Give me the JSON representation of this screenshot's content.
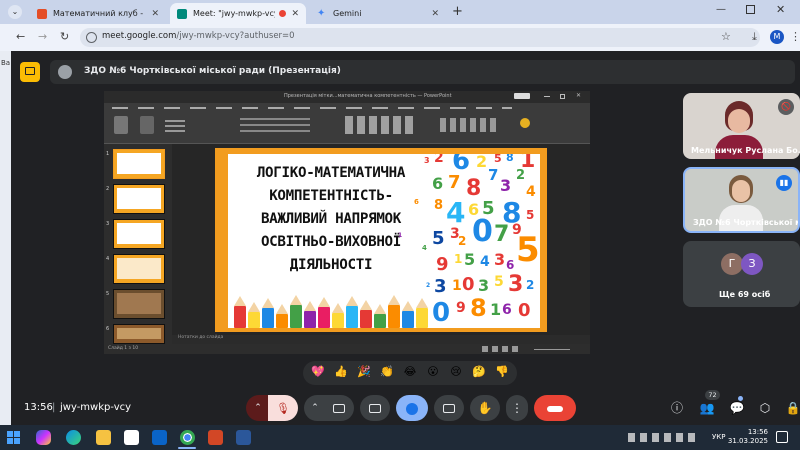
{
  "browser": {
    "tabs": [
      {
        "title": "Математичний клуб - rumelnyk...",
        "favicon": "blogger-icon",
        "color": "#e44d26",
        "active": false
      },
      {
        "title": "Meet: \"jwy-mwkp-vcy\"",
        "favicon": "meet-icon",
        "color": "#00897b",
        "active": true
      },
      {
        "title": "Gemini",
        "favicon": "gemini-icon",
        "color": "#4285f4",
        "active": false
      }
    ],
    "url_host": "meet.google.com",
    "url_path": "/jwy-mwkp-vcy?authuser=0",
    "profile_initial": "M",
    "left_strip_text": "Ba"
  },
  "meet": {
    "presentation_title": "ЗДО №6 Чортківської міської ради (Презентація)",
    "time": "13:56",
    "meeting_code": "jwy-mwkp-vcy",
    "participants": [
      {
        "name": "Мельничук Руслана Бо...",
        "muted": true
      },
      {
        "name": "ЗДО №6 Чортківської м...",
        "speaking": true
      }
    ],
    "others": {
      "label": "Ще 69 осіб",
      "avatars": [
        {
          "initial": "Г",
          "color": "#8d6e63"
        },
        {
          "initial": "З",
          "color": "#7e57c2"
        }
      ]
    },
    "reactions": [
      "💖",
      "👍",
      "🎉",
      "👏",
      "😂",
      "😮",
      "😢",
      "🤔",
      "👎"
    ],
    "people_count": "72"
  },
  "ppt": {
    "window_title": "Презентація мітки...математична компетентність — PowerPoint",
    "notes_placeholder": "Нотатки до слайда",
    "slide_numbers": [
      "1",
      "2",
      "3",
      "4",
      "5",
      "6"
    ],
    "slide_title_lines": [
      "ЛОГІКО-МАТЕМАТИЧНА",
      "КОМПЕТЕНТНІСТЬ-",
      "ВАЖЛИВИЙ НАПРЯМОК",
      "ОСВІТНЬО-ВИХОВНОЇ",
      "ДІЯЛЬНОСТІ"
    ],
    "status_left": "Слайд 1 з 10"
  },
  "taskbar": {
    "lang": "УКР",
    "time": "13:56",
    "date": "31.03.2025"
  },
  "colors": {
    "slide_border": "#f29c1f",
    "meet_bg": "#202124",
    "end_call": "#ea4335",
    "mic_off_bg": "#f9dedc",
    "active_btn": "#8ab4f8"
  }
}
